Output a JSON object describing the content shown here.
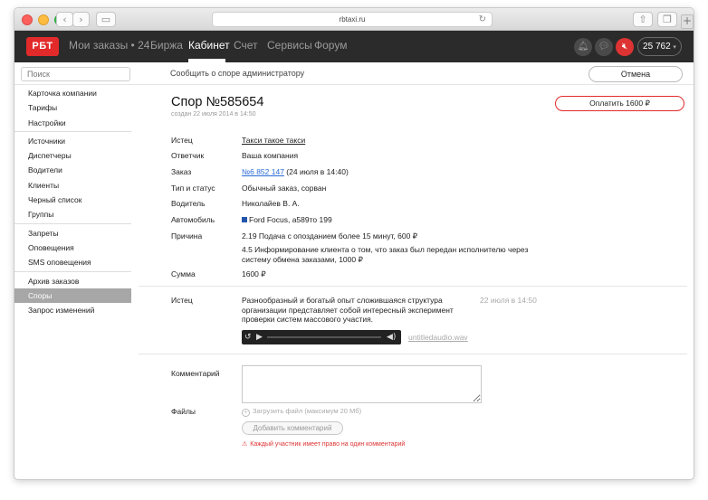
{
  "browser": {
    "url": "rbtaxi.ru",
    "back_icon": "chevron-left-icon",
    "forward_icon": "chevron-right-icon",
    "sidebar_icon": "sidebar-icon",
    "share_icon": "share-icon",
    "tabs_icon": "tabs-icon",
    "new_tab_icon": "plus-icon"
  },
  "topnav": {
    "logo": "РБТ",
    "items": [
      {
        "label": "Мои заказы • 24",
        "active": false
      },
      {
        "label": "Биржа",
        "active": false
      },
      {
        "label": "Кабинет",
        "active": true
      },
      {
        "label": "Счет",
        "active": false
      },
      {
        "label": "Сервисы",
        "active": false
      },
      {
        "label": "Форум",
        "active": false
      }
    ],
    "icons": [
      "bell-icon",
      "chat-icon",
      "mute-icon"
    ],
    "balance": "25 762",
    "balance_arrow": "▾",
    "brand_color": "#e22a2a"
  },
  "subbar": {
    "search_placeholder": "Поиск",
    "subtitle": "Сообщить о споре администратору",
    "cancel": "Отмена"
  },
  "sidebar": {
    "groups": [
      [
        "Карточка компании",
        "Тарифы",
        "Настройки"
      ],
      [
        "Источники",
        "Диспетчеры",
        "Водители",
        "Клиенты",
        "Черный список",
        "Группы"
      ],
      [
        "Запреты",
        "Оповещения",
        "SMS оповещения"
      ],
      [
        "Архив заказов",
        "Споры",
        "Запрос изменений"
      ]
    ],
    "active": "Споры"
  },
  "dispute": {
    "title": "Спор №585654",
    "created": "создан 22 июля 2014 в 14:50",
    "pay_button": "Оплатить 1600 ₽",
    "fields": {
      "plaintiff_label": "Истец",
      "plaintiff_value": "Такси такое такси",
      "defendant_label": "Ответчик",
      "defendant_value": "Ваша компания",
      "order_label": "Заказ",
      "order_link": "№6 852 147",
      "order_date": " (24 июля в 14:40)",
      "type_label": "Тип и статус",
      "type_value": "Обычный заказ, сорван",
      "driver_label": "Водитель",
      "driver_value": "Николайев В. А.",
      "car_label": "Автомобиль",
      "car_value": "Ford Focus, а589то 199",
      "reason_label": "Причина",
      "reason_1": "2.19 Подача с опозданием более 15 минут, 600 ₽",
      "reason_2": "4.5 Информирование клиента о том, что заказ был передан исполнителю через систему обмена заказами, 1000 ₽",
      "sum_label": "Сумма",
      "sum_value": "1600 ₽"
    }
  },
  "message": {
    "author": "Истец",
    "text": "Разнообразный и богатый опыт сложившаяся структура организации представляет собой интересный эксперимент проверки систем массового участия.",
    "time": "22 июля в 14:50",
    "audio_file": "untitledaudio.wav"
  },
  "form": {
    "comment_label": "Комментарий",
    "files_label": "Файлы",
    "upload_text": "Загрузить файл (максимум 20 Мб)",
    "submit": "Добавить комментарий",
    "warning": "Каждый участник имеет право на один комментарий"
  }
}
